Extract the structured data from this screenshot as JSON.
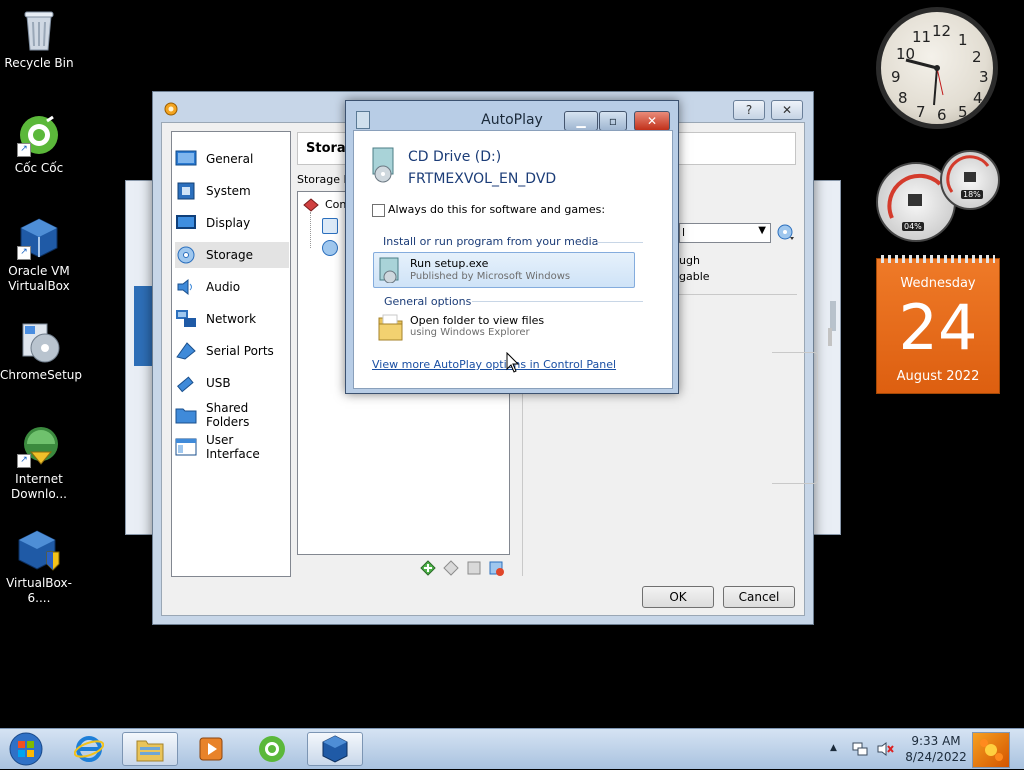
{
  "desktop": {
    "icons": [
      {
        "label": "Recycle Bin"
      },
      {
        "label": "Cốc Cốc"
      },
      {
        "label": "Oracle VM VirtualBox"
      },
      {
        "label": "ChromeSetup"
      },
      {
        "label": "Internet Downlo..."
      },
      {
        "label": "VirtualBox-6...."
      }
    ]
  },
  "settings": {
    "title_help": "?",
    "title_close": "✕",
    "categories": [
      {
        "label": "General"
      },
      {
        "label": "System"
      },
      {
        "label": "Display"
      },
      {
        "label": "Storage"
      },
      {
        "label": "Audio"
      },
      {
        "label": "Network"
      },
      {
        "label": "Serial Ports"
      },
      {
        "label": "USB"
      },
      {
        "label": "Shared Folders"
      },
      {
        "label": "User Interface"
      }
    ],
    "section_title": "Storag",
    "storage_devices_label": "Storage De",
    "tree_controller": "Cont",
    "attr_partial_1": "ugh",
    "attr_partial_2": "gable",
    "attr_partial_select": "l",
    "ok_label": "OK",
    "cancel_label": "Cancel"
  },
  "autoplay": {
    "title": "AutoPlay",
    "drive_name": "CD Drive (D:)",
    "volume_label": "FRTMEXVOL_EN_DVD",
    "always_do_label": "Always do this for software and games:",
    "section_install": "Install or run program from your media",
    "run_setup_title": "Run setup.exe",
    "run_setup_sub": "Published by Microsoft Windows",
    "section_general": "General options",
    "open_folder_title": "Open folder to view files",
    "open_folder_sub": "using Windows Explorer",
    "control_panel_link": "View more AutoPlay options in Control Panel"
  },
  "gadgets": {
    "clock_numbers": [
      "12",
      "1",
      "2",
      "3",
      "4",
      "5",
      "6",
      "7",
      "8",
      "9",
      "10",
      "11"
    ],
    "cpu_percent": "04%",
    "mem_percent": "18%",
    "calendar_weekday": "Wednesday",
    "calendar_day": "24",
    "calendar_month_year": "August 2022"
  },
  "taskbar": {
    "time": "9:33 AM",
    "date": "8/24/2022",
    "tray_arrow": "▲"
  },
  "colors": {
    "accent_link": "#1a4fa3",
    "calendar_orange": "#e8691b",
    "selection_blue": "#cde3f7"
  }
}
